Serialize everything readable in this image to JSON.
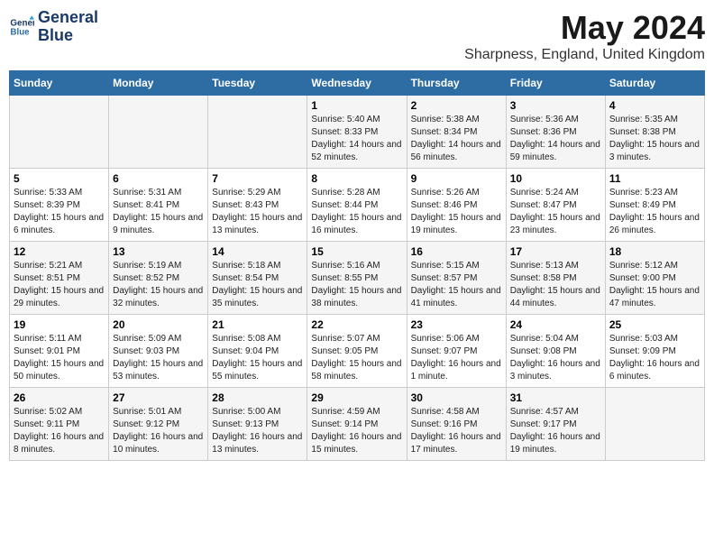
{
  "logo": {
    "line1": "General",
    "line2": "Blue"
  },
  "title": "May 2024",
  "subtitle": "Sharpness, England, United Kingdom",
  "weekdays": [
    "Sunday",
    "Monday",
    "Tuesday",
    "Wednesday",
    "Thursday",
    "Friday",
    "Saturday"
  ],
  "weeks": [
    [
      {
        "day": "",
        "content": ""
      },
      {
        "day": "",
        "content": ""
      },
      {
        "day": "",
        "content": ""
      },
      {
        "day": "1",
        "content": "Sunrise: 5:40 AM\nSunset: 8:33 PM\nDaylight: 14 hours and 52 minutes."
      },
      {
        "day": "2",
        "content": "Sunrise: 5:38 AM\nSunset: 8:34 PM\nDaylight: 14 hours and 56 minutes."
      },
      {
        "day": "3",
        "content": "Sunrise: 5:36 AM\nSunset: 8:36 PM\nDaylight: 14 hours and 59 minutes."
      },
      {
        "day": "4",
        "content": "Sunrise: 5:35 AM\nSunset: 8:38 PM\nDaylight: 15 hours and 3 minutes."
      }
    ],
    [
      {
        "day": "5",
        "content": "Sunrise: 5:33 AM\nSunset: 8:39 PM\nDaylight: 15 hours and 6 minutes."
      },
      {
        "day": "6",
        "content": "Sunrise: 5:31 AM\nSunset: 8:41 PM\nDaylight: 15 hours and 9 minutes."
      },
      {
        "day": "7",
        "content": "Sunrise: 5:29 AM\nSunset: 8:43 PM\nDaylight: 15 hours and 13 minutes."
      },
      {
        "day": "8",
        "content": "Sunrise: 5:28 AM\nSunset: 8:44 PM\nDaylight: 15 hours and 16 minutes."
      },
      {
        "day": "9",
        "content": "Sunrise: 5:26 AM\nSunset: 8:46 PM\nDaylight: 15 hours and 19 minutes."
      },
      {
        "day": "10",
        "content": "Sunrise: 5:24 AM\nSunset: 8:47 PM\nDaylight: 15 hours and 23 minutes."
      },
      {
        "day": "11",
        "content": "Sunrise: 5:23 AM\nSunset: 8:49 PM\nDaylight: 15 hours and 26 minutes."
      }
    ],
    [
      {
        "day": "12",
        "content": "Sunrise: 5:21 AM\nSunset: 8:51 PM\nDaylight: 15 hours and 29 minutes."
      },
      {
        "day": "13",
        "content": "Sunrise: 5:19 AM\nSunset: 8:52 PM\nDaylight: 15 hours and 32 minutes."
      },
      {
        "day": "14",
        "content": "Sunrise: 5:18 AM\nSunset: 8:54 PM\nDaylight: 15 hours and 35 minutes."
      },
      {
        "day": "15",
        "content": "Sunrise: 5:16 AM\nSunset: 8:55 PM\nDaylight: 15 hours and 38 minutes."
      },
      {
        "day": "16",
        "content": "Sunrise: 5:15 AM\nSunset: 8:57 PM\nDaylight: 15 hours and 41 minutes."
      },
      {
        "day": "17",
        "content": "Sunrise: 5:13 AM\nSunset: 8:58 PM\nDaylight: 15 hours and 44 minutes."
      },
      {
        "day": "18",
        "content": "Sunrise: 5:12 AM\nSunset: 9:00 PM\nDaylight: 15 hours and 47 minutes."
      }
    ],
    [
      {
        "day": "19",
        "content": "Sunrise: 5:11 AM\nSunset: 9:01 PM\nDaylight: 15 hours and 50 minutes."
      },
      {
        "day": "20",
        "content": "Sunrise: 5:09 AM\nSunset: 9:03 PM\nDaylight: 15 hours and 53 minutes."
      },
      {
        "day": "21",
        "content": "Sunrise: 5:08 AM\nSunset: 9:04 PM\nDaylight: 15 hours and 55 minutes."
      },
      {
        "day": "22",
        "content": "Sunrise: 5:07 AM\nSunset: 9:05 PM\nDaylight: 15 hours and 58 minutes."
      },
      {
        "day": "23",
        "content": "Sunrise: 5:06 AM\nSunset: 9:07 PM\nDaylight: 16 hours and 1 minute."
      },
      {
        "day": "24",
        "content": "Sunrise: 5:04 AM\nSunset: 9:08 PM\nDaylight: 16 hours and 3 minutes."
      },
      {
        "day": "25",
        "content": "Sunrise: 5:03 AM\nSunset: 9:09 PM\nDaylight: 16 hours and 6 minutes."
      }
    ],
    [
      {
        "day": "26",
        "content": "Sunrise: 5:02 AM\nSunset: 9:11 PM\nDaylight: 16 hours and 8 minutes."
      },
      {
        "day": "27",
        "content": "Sunrise: 5:01 AM\nSunset: 9:12 PM\nDaylight: 16 hours and 10 minutes."
      },
      {
        "day": "28",
        "content": "Sunrise: 5:00 AM\nSunset: 9:13 PM\nDaylight: 16 hours and 13 minutes."
      },
      {
        "day": "29",
        "content": "Sunrise: 4:59 AM\nSunset: 9:14 PM\nDaylight: 16 hours and 15 minutes."
      },
      {
        "day": "30",
        "content": "Sunrise: 4:58 AM\nSunset: 9:16 PM\nDaylight: 16 hours and 17 minutes."
      },
      {
        "day": "31",
        "content": "Sunrise: 4:57 AM\nSunset: 9:17 PM\nDaylight: 16 hours and 19 minutes."
      },
      {
        "day": "",
        "content": ""
      }
    ]
  ]
}
